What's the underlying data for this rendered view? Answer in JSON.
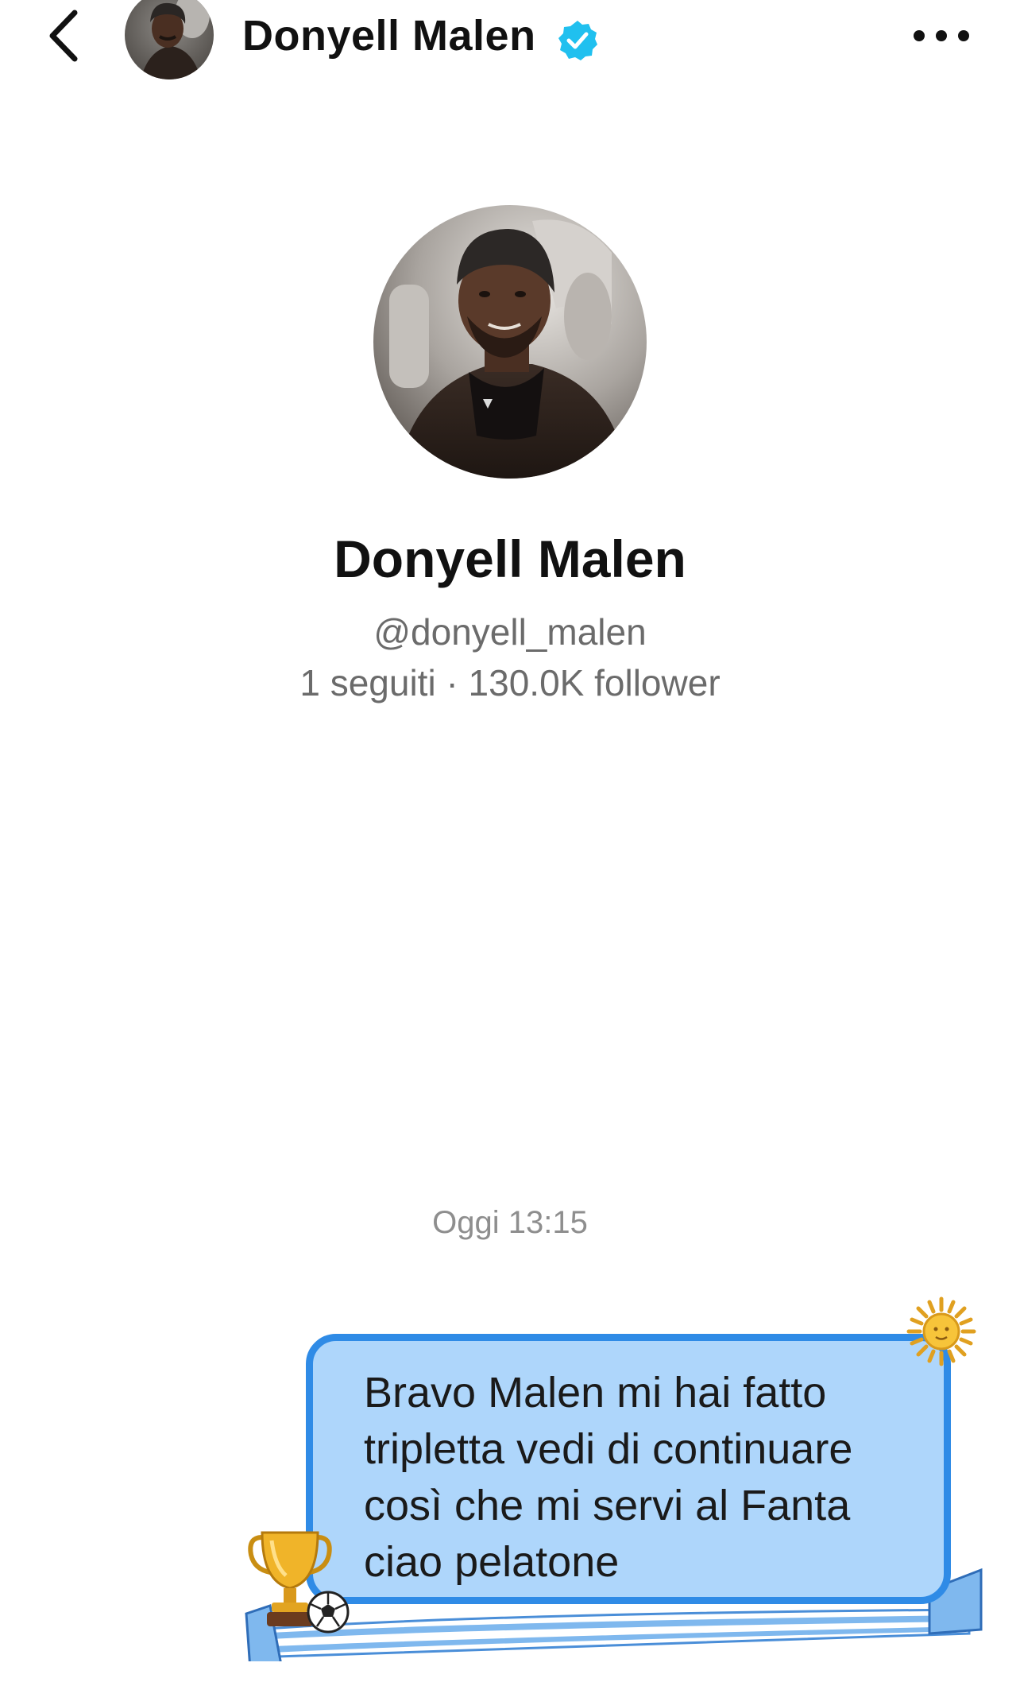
{
  "header": {
    "back_icon": "chevron-left-icon",
    "name": "Donyell Malen",
    "verified_icon": "verified-badge-icon",
    "more_icon": "more-horizontal-icon"
  },
  "profile": {
    "name": "Donyell Malen",
    "handle": "@donyell_malen",
    "stats": "1 seguiti · 130.0K follower"
  },
  "conversation": {
    "timestamp": "Oggi 13:15",
    "messages": [
      {
        "sender": "me",
        "text": "Bravo Malen mi hai fatto tripletta vedi di continuare così che mi servi al Fanta ciao pelatone",
        "decorations": [
          "sun-of-may-icon",
          "trophy-icon",
          "soccer-ball-icon",
          "argentina-scarf-icon"
        ]
      }
    ]
  },
  "colors": {
    "bubble_fill": "#aed6fb",
    "bubble_border": "#2f8be6",
    "verified": "#20c0ef",
    "secondary_text": "#6b6b6b"
  }
}
